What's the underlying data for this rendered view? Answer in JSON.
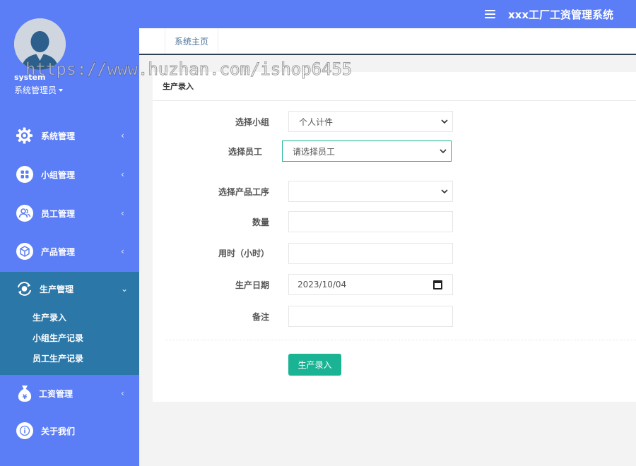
{
  "header": {
    "title": "xxx工厂工资管理系统",
    "menu_icon": "hamburger-icon"
  },
  "user": {
    "name": "system",
    "role": "系统管理员"
  },
  "sidebar": {
    "items": [
      {
        "label": "系统管理",
        "icon": "gear-icon"
      },
      {
        "label": "小组管理",
        "icon": "grid-icon"
      },
      {
        "label": "员工管理",
        "icon": "users-icon"
      },
      {
        "label": "产品管理",
        "icon": "box-icon"
      },
      {
        "label": "生产管理",
        "icon": "refresh-icon",
        "expanded": true,
        "children": [
          "生产录入",
          "小组生产记录",
          "员工生产记录"
        ]
      },
      {
        "label": "工资管理",
        "icon": "money-bag-icon"
      },
      {
        "label": "关于我们",
        "icon": "info-icon"
      }
    ]
  },
  "tabs": [
    {
      "label": "系统主页"
    }
  ],
  "panel": {
    "title": "生产录入",
    "fields": {
      "group": {
        "label": "选择小组",
        "value": "个人计件"
      },
      "employee": {
        "label": "选择员工",
        "value": "请选择员工"
      },
      "process": {
        "label": "选择产品工序",
        "value": ""
      },
      "quantity": {
        "label": "数量",
        "value": ""
      },
      "hours": {
        "label": "用时（小时）",
        "value": ""
      },
      "date": {
        "label": "生产日期",
        "value": "2023/10/04"
      },
      "remark": {
        "label": "备注",
        "value": ""
      }
    },
    "submit_label": "生产录入"
  },
  "watermark": "https://www.huzhan.com/ishop6455",
  "colors": {
    "primary": "#5b7ef6",
    "active_section": "#2b77a8",
    "accent": "#1ab394"
  }
}
